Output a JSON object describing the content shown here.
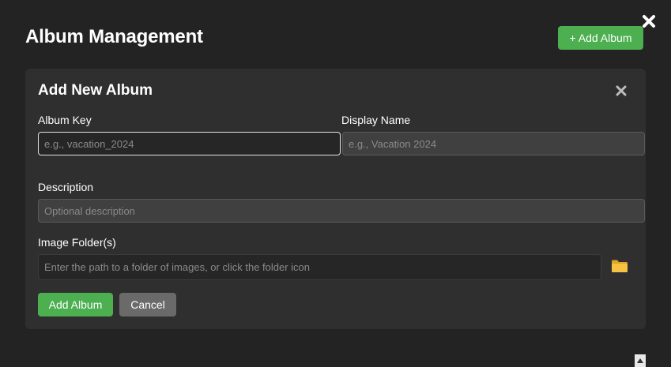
{
  "header": {
    "title": "Album Management",
    "add_button_label": "+ Add Album",
    "close_icon": "close-icon"
  },
  "form": {
    "title": "Add New Album",
    "close_icon": "close-icon",
    "album_key": {
      "label": "Album Key",
      "value": "",
      "placeholder": "e.g., vacation_2024"
    },
    "display_name": {
      "label": "Display Name",
      "value": "",
      "placeholder": "e.g., Vacation 2024"
    },
    "description": {
      "label": "Description",
      "value": "",
      "placeholder": "Optional description"
    },
    "image_folder": {
      "label": "Image Folder(s)",
      "value": "",
      "placeholder": "Enter the path to a folder of images, or click the folder icon",
      "browse_icon": "folder-icon"
    },
    "submit_label": "Add Album",
    "cancel_label": "Cancel"
  },
  "colors": {
    "accent_green": "#4caf50",
    "cancel_grey": "#6a6a6a",
    "panel_bg": "#2f2f2f",
    "modal_bg": "#232323"
  }
}
